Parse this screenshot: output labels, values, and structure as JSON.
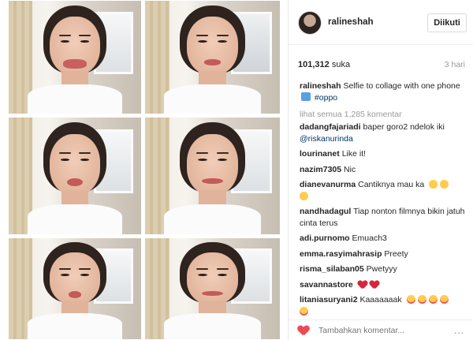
{
  "post": {
    "username": "ralineshah",
    "follow_label": "Diikuti",
    "likes_count": "101,312",
    "likes_suffix": "suka",
    "time_ago": "3 hari",
    "caption_user": "ralineshah",
    "caption_text": "Selfie to collage with one phone",
    "caption_hashtag": "#oppo",
    "view_all": "lihat semua 1,285 komentar",
    "add_comment_placeholder": "Tambahkan komentar...",
    "more_label": "…"
  },
  "comments": [
    {
      "user": "dadangfajariadi",
      "text": "baper goro2 ndelok iki",
      "mention": "@riskanurinda"
    },
    {
      "user": "lourinanet",
      "text": "Like it!"
    },
    {
      "user": "nazim7305",
      "text": "Nic"
    },
    {
      "user": "dianevanurma",
      "text": "Cantiknya mau ka"
    },
    {
      "user": "nandhadagul",
      "text": "Tiap nonton filmnya bikin jatuh cinta terus"
    },
    {
      "user": "adi.purnomo",
      "text": "Emuach3"
    },
    {
      "user": "emma.rasyimahrasip",
      "text": "Preety"
    },
    {
      "user": "risma_silaban05",
      "text": "Pwetyyy"
    },
    {
      "user": "savannastore",
      "text": ""
    },
    {
      "user": "litaniasuryani2",
      "text": "Kaaaaaaak"
    }
  ],
  "icons": {
    "like": "heart-icon",
    "emoji": "emoji-icon",
    "more": "more-options-icon"
  },
  "colors": {
    "link": "#003569",
    "like_heart": "#ed4956",
    "muted": "#999999"
  }
}
